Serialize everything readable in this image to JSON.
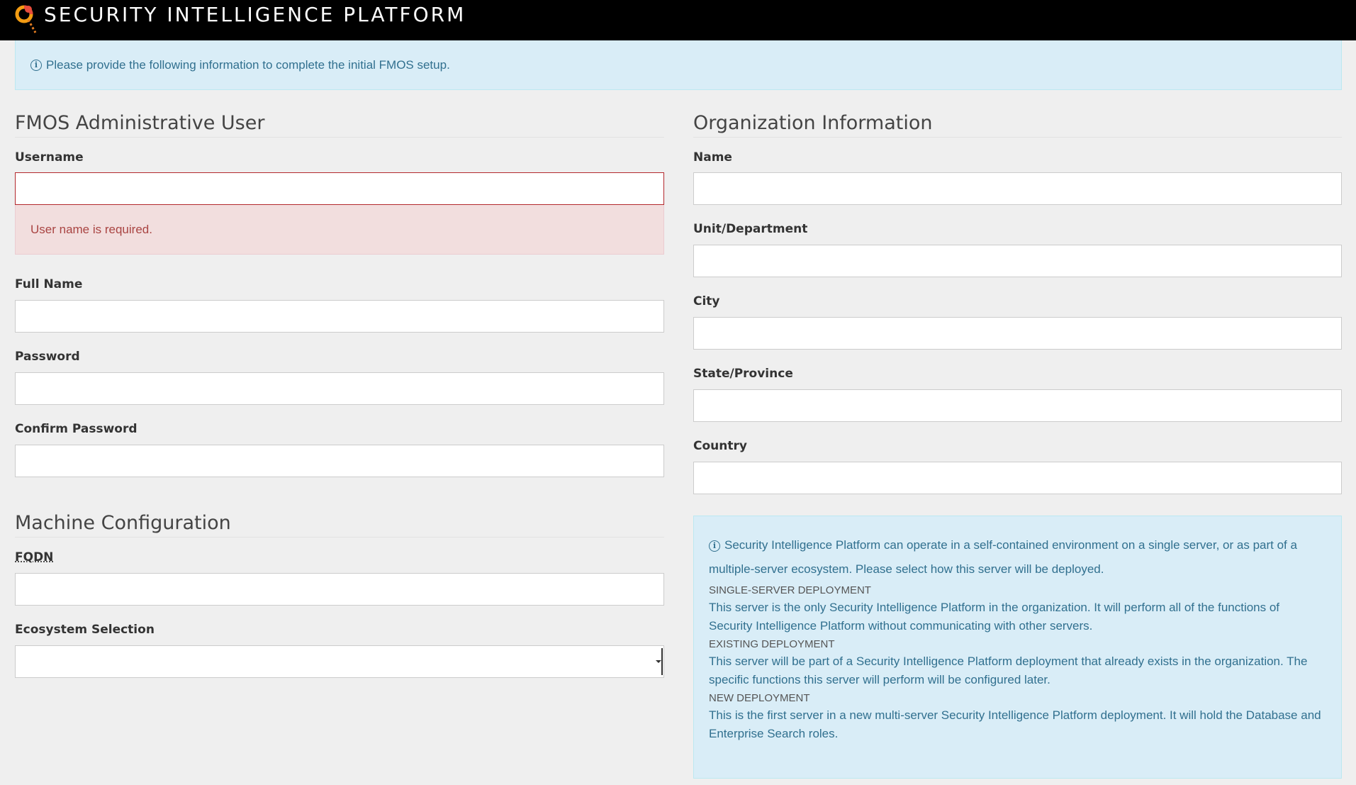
{
  "header": {
    "brand": "SECURITY INTELLIGENCE PLATFORM",
    "logo_icon": "magnifier-logo-icon",
    "background": "#000000"
  },
  "top_alert": {
    "icon": "info-icon",
    "text": "Please provide the following information to complete the initial FMOS setup."
  },
  "admin_user": {
    "title": "FMOS Administrative User",
    "username": {
      "label": "Username",
      "value": "",
      "error": "User name is required."
    },
    "full_name": {
      "label": "Full Name",
      "value": ""
    },
    "password": {
      "label": "Password",
      "value": ""
    },
    "confirm_password": {
      "label": "Confirm Password",
      "value": ""
    }
  },
  "machine": {
    "title": "Machine Configuration",
    "fqdn": {
      "label": "FQDN",
      "value": ""
    },
    "ecosystem": {
      "label": "Ecosystem Selection",
      "selected": ""
    }
  },
  "organization": {
    "title": "Organization Information",
    "name": {
      "label": "Name",
      "value": ""
    },
    "unit": {
      "label": "Unit/Department",
      "value": ""
    },
    "city": {
      "label": "City",
      "value": ""
    },
    "state": {
      "label": "State/Province",
      "value": ""
    },
    "country": {
      "label": "Country",
      "value": ""
    }
  },
  "deployment_info": {
    "icon": "info-icon",
    "lead": "Security Intelligence Platform can operate in a self-contained environment on a single server, or as part of a multiple-server ecosystem. Please select how this server will be deployed.",
    "single": {
      "heading": "Single-Server Deployment",
      "text": "This server is the only Security Intelligence Platform in the organization. It will perform all of the functions of Security Intelligence Platform without communicating with other servers."
    },
    "existing": {
      "heading": "Existing Deployment",
      "text": "This server will be part of a Security Intelligence Platform deployment that already exists in the organization. The specific functions this server will perform will be configured later."
    },
    "new": {
      "heading": "New Deployment",
      "text": "This is the first server in a new multi-server Security Intelligence Platform deployment. It will hold the Database and Enterprise Search roles."
    }
  },
  "colors": {
    "info_bg": "#d9edf7",
    "info_text": "#31708f",
    "error_bg": "#f2dede",
    "error_text": "#a94442",
    "error_border": "#b3282d",
    "page_bg": "#efefef"
  }
}
